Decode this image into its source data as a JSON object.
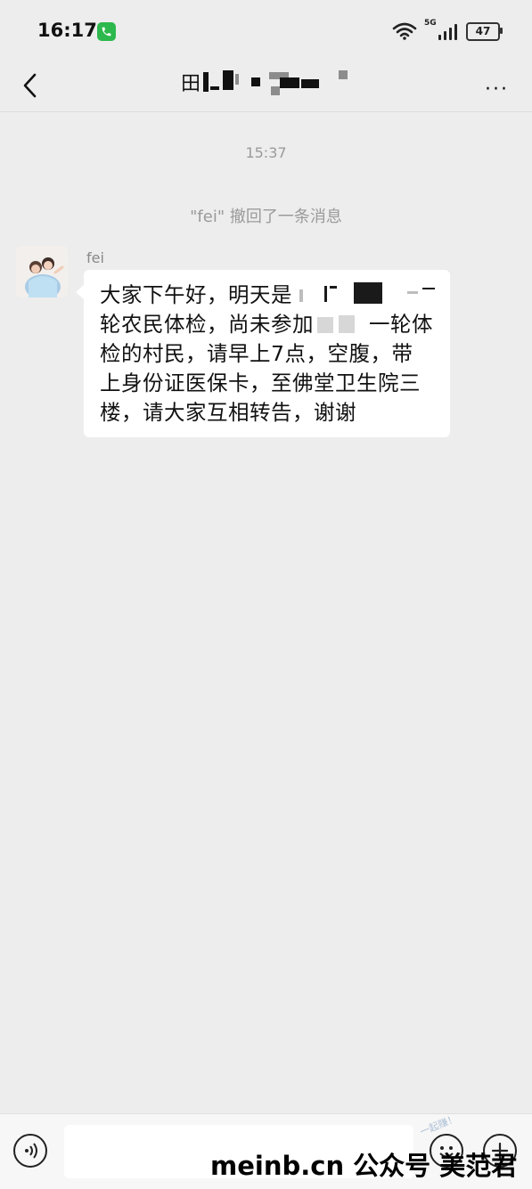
{
  "status_bar": {
    "time": "16:17",
    "network_label": "5G",
    "battery": "47",
    "icons": [
      "phone-call-icon",
      "wifi-icon",
      "signal-icon",
      "battery-icon"
    ]
  },
  "header": {
    "title_visible": "田",
    "back_icon": "chevron-left-icon",
    "more_icon": "more-dots-icon",
    "more_text": "···"
  },
  "chat": {
    "timestamp": "15:37",
    "system_message": "\"fei\" 撤回了一条消息",
    "messages": [
      {
        "sender": "fei",
        "lines": [
          "大家下午好，明天是",
          "轮农民体检，尚未参加",
          "一轮体",
          "检的村民，请早上7点，空腹，带",
          "上身份证医保卡，至佛堂卫生院三",
          "楼，请大家互相转告，谢谢"
        ]
      }
    ]
  },
  "input_bar": {
    "voice_icon": "voice-icon",
    "emoji_icon": "emoji-icon",
    "plus_icon": "plus-icon"
  },
  "watermark": {
    "text": "meinb.cn 公众号 美范君",
    "faint_text": "一起赚！"
  },
  "colors": {
    "background": "#ededed",
    "bubble": "#ffffff",
    "wechat_green": "#2db84d",
    "muted_text": "#9a9a9a"
  }
}
